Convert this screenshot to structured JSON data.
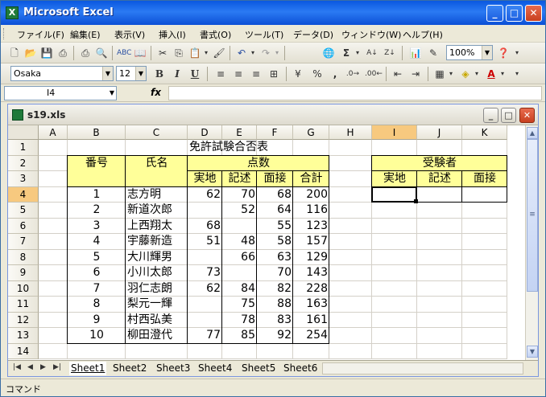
{
  "app": {
    "title": "Microsoft Excel"
  },
  "menu": [
    "ファイル(F)",
    "編集(E)",
    "表示(V)",
    "挿入(I)",
    "書式(O)",
    "ツール(T)",
    "データ(D)",
    "ウィンドウ(W)",
    "ヘルプ(H)"
  ],
  "toolbar": {
    "zoom": "100%"
  },
  "format": {
    "font": "Osaka",
    "size": "12",
    "bold": "B",
    "italic": "I",
    "underline": "U",
    "percent": "%",
    "comma": ","
  },
  "formula": {
    "name_box": "I4",
    "fx": "fx",
    "value": ""
  },
  "workbook": {
    "title": "s19.xls"
  },
  "columns": [
    "A",
    "B",
    "C",
    "D",
    "E",
    "F",
    "G",
    "H",
    "I",
    "J",
    "K"
  ],
  "rows": [
    "1",
    "2",
    "3",
    "4",
    "5",
    "6",
    "7",
    "8",
    "9",
    "10",
    "11",
    "12",
    "13",
    "14"
  ],
  "sheet": {
    "title": "免許試験合否表",
    "headers": {
      "num": "番号",
      "name": "氏名",
      "points": "点数",
      "jitchi": "実地",
      "kijutsu": "記述",
      "mensetsu": "面接",
      "total": "合計"
    },
    "examinees": {
      "title": "受験者",
      "jitchi": "実地",
      "kijutsu": "記述",
      "mensetsu": "面接"
    },
    "data": [
      {
        "no": "1",
        "name": "志方明",
        "d": "62",
        "e": "70",
        "f": "68",
        "g": "200"
      },
      {
        "no": "2",
        "name": "新道次郎",
        "d": "",
        "e": "52",
        "f": "64",
        "g": "116"
      },
      {
        "no": "3",
        "name": "上西翔太",
        "d": "68",
        "e": "",
        "f": "55",
        "g": "123"
      },
      {
        "no": "4",
        "name": "宇藤新造",
        "d": "51",
        "e": "48",
        "f": "58",
        "g": "157"
      },
      {
        "no": "5",
        "name": "大川輝男",
        "d": "",
        "e": "66",
        "f": "63",
        "g": "129"
      },
      {
        "no": "6",
        "name": "小川太郎",
        "d": "73",
        "e": "",
        "f": "70",
        "g": "143"
      },
      {
        "no": "7",
        "name": "羽仁志朗",
        "d": "62",
        "e": "84",
        "f": "82",
        "g": "228"
      },
      {
        "no": "8",
        "name": "梨元一輝",
        "d": "",
        "e": "75",
        "f": "88",
        "g": "163"
      },
      {
        "no": "9",
        "name": "村西弘美",
        "d": "",
        "e": "78",
        "f": "83",
        "g": "161"
      },
      {
        "no": "10",
        "name": "柳田澄代",
        "d": "77",
        "e": "85",
        "f": "92",
        "g": "254"
      }
    ]
  },
  "tabs": [
    "Sheet1",
    "Sheet2",
    "Sheet3",
    "Sheet4",
    "Sheet5",
    "Sheet6"
  ],
  "status": {
    "mode": "コマンド"
  },
  "colors": {
    "header_fill": "#ffff99",
    "selection": "#f7c97f",
    "titlebar": "#0a58e0"
  }
}
